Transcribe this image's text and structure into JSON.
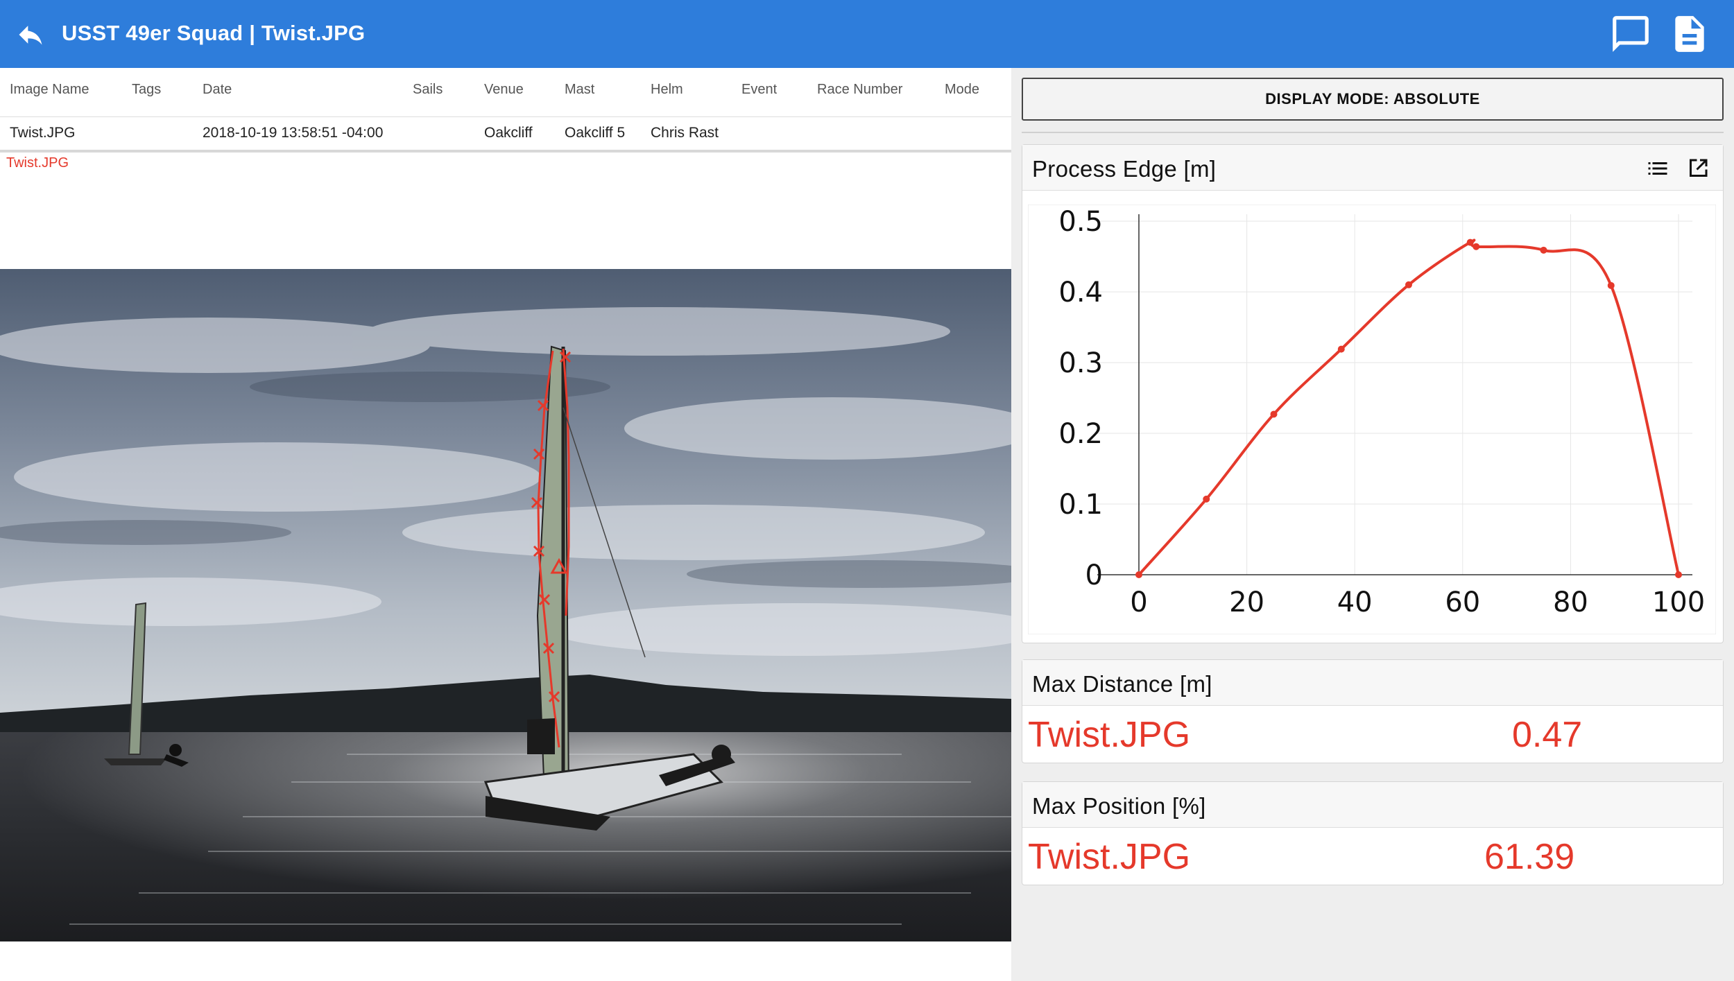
{
  "app": {
    "title": "USST 49er Squad | Twist.JPG"
  },
  "table": {
    "columns": [
      "Image Name",
      "Tags",
      "Date",
      "Sails",
      "Venue",
      "Mast",
      "Helm",
      "Event",
      "Race Number",
      "Mode"
    ],
    "rows": [
      [
        "Twist.JPG",
        "",
        "2018-10-19 13:58:51 -04:00",
        "",
        "Oakcliff",
        "Oakcliff 5",
        "Chris Rast",
        "",
        "",
        ""
      ]
    ]
  },
  "image": {
    "caption": "Twist.JPG"
  },
  "display_mode": {
    "label": "DISPLAY MODE: ABSOLUTE"
  },
  "process_edge": {
    "title": "Process Edge [m]"
  },
  "chart_data": {
    "type": "line",
    "title": "Process Edge [m]",
    "xlabel": "",
    "ylabel": "",
    "xlim": [
      0,
      100
    ],
    "ylim": [
      0,
      0.5
    ],
    "x_ticks": [
      0,
      20,
      40,
      60,
      80,
      100
    ],
    "y_ticks": [
      0,
      0.1,
      0.2,
      0.3,
      0.4,
      0.5
    ],
    "grid": true,
    "color": "#e5392b",
    "series": [
      {
        "x": [
          0,
          12.5,
          25,
          37.5,
          50,
          61.4,
          62.5,
          75,
          87.5,
          100
        ],
        "y": [
          0,
          0.107,
          0.227,
          0.319,
          0.41,
          0.47,
          0.464,
          0.459,
          0.409,
          0
        ]
      }
    ]
  },
  "max_distance": {
    "title": "Max Distance [m]",
    "name": "Twist.JPG",
    "value": "0.47"
  },
  "max_position": {
    "title": "Max Position [%]",
    "name": "Twist.JPG",
    "value": "61.39"
  },
  "colors": {
    "appbar": "#2e7ddb",
    "accent_red": "#e5392b",
    "panel_bg": "#eeeeee"
  },
  "icons": {
    "back": "reply-arrow-icon",
    "comment": "comment-icon",
    "report": "document-icon",
    "list": "list-icon",
    "open": "open-in-new-icon"
  }
}
